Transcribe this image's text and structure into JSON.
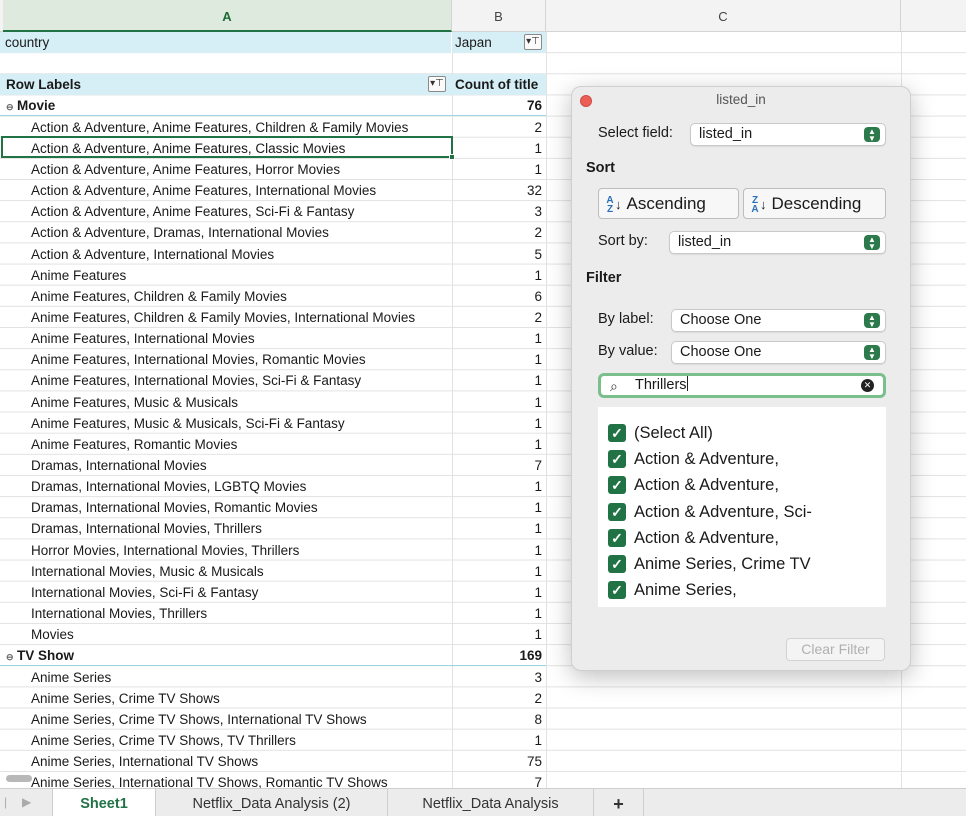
{
  "columns": {
    "a": "A",
    "b": "B",
    "c": "C"
  },
  "filter_field": {
    "label": "country",
    "value": "Japan"
  },
  "pivot_header": {
    "row_labels": "Row Labels",
    "count": "Count of title"
  },
  "groups": [
    {
      "label": "Movie",
      "total": "76",
      "items": [
        {
          "label": "Action & Adventure, Anime Features, Children & Family Movies",
          "count": "2"
        },
        {
          "label": "Action & Adventure, Anime Features, Classic Movies",
          "count": "1"
        },
        {
          "label": "Action & Adventure, Anime Features, Horror Movies",
          "count": "1"
        },
        {
          "label": "Action & Adventure, Anime Features, International Movies",
          "count": "32"
        },
        {
          "label": "Action & Adventure, Anime Features, Sci-Fi & Fantasy",
          "count": "3"
        },
        {
          "label": "Action & Adventure, Dramas, International Movies",
          "count": "2"
        },
        {
          "label": "Action & Adventure, International Movies",
          "count": "5"
        },
        {
          "label": "Anime Features",
          "count": "1"
        },
        {
          "label": "Anime Features, Children & Family Movies",
          "count": "6"
        },
        {
          "label": "Anime Features, Children & Family Movies, International Movies",
          "count": "2"
        },
        {
          "label": "Anime Features, International Movies",
          "count": "1"
        },
        {
          "label": "Anime Features, International Movies, Romantic Movies",
          "count": "1"
        },
        {
          "label": "Anime Features, International Movies, Sci-Fi & Fantasy",
          "count": "1"
        },
        {
          "label": "Anime Features, Music & Musicals",
          "count": "1"
        },
        {
          "label": "Anime Features, Music & Musicals, Sci-Fi & Fantasy",
          "count": "1"
        },
        {
          "label": "Anime Features, Romantic Movies",
          "count": "1"
        },
        {
          "label": "Dramas, International Movies",
          "count": "7"
        },
        {
          "label": "Dramas, International Movies, LGBTQ Movies",
          "count": "1"
        },
        {
          "label": "Dramas, International Movies, Romantic Movies",
          "count": "1"
        },
        {
          "label": "Dramas, International Movies, Thrillers",
          "count": "1"
        },
        {
          "label": "Horror Movies, International Movies, Thrillers",
          "count": "1"
        },
        {
          "label": "International Movies, Music & Musicals",
          "count": "1"
        },
        {
          "label": "International Movies, Sci-Fi & Fantasy",
          "count": "1"
        },
        {
          "label": "International Movies, Thrillers",
          "count": "1"
        },
        {
          "label": "Movies",
          "count": "1"
        }
      ]
    },
    {
      "label": "TV Show",
      "total": "169",
      "items": [
        {
          "label": "Anime Series",
          "count": "3"
        },
        {
          "label": "Anime Series, Crime TV Shows",
          "count": "2"
        },
        {
          "label": "Anime Series, Crime TV Shows, International TV Shows",
          "count": "8"
        },
        {
          "label": "Anime Series, Crime TV Shows, TV Thrillers",
          "count": "1"
        },
        {
          "label": "Anime Series, International TV Shows",
          "count": "75"
        },
        {
          "label": "Anime Series, International TV Shows, Romantic TV Shows",
          "count": "7"
        }
      ]
    }
  ],
  "panel": {
    "title": "listed_in",
    "select_field_label": "Select field:",
    "select_field_value": "listed_in",
    "sort_heading": "Sort",
    "ascending": "Ascending",
    "descending": "Descending",
    "sort_by_label": "Sort by:",
    "sort_by_value": "listed_in",
    "filter_heading": "Filter",
    "by_label_label": "By label:",
    "by_label_value": "Choose One",
    "by_value_label": "By value:",
    "by_value_value": "Choose One",
    "search_value": "Thrillers",
    "list_items": [
      "(Select All)",
      "Action & Adventure,",
      "Action & Adventure,",
      "Action & Adventure, Sci-",
      "Action & Adventure,",
      "Anime Series, Crime TV",
      "Anime Series,"
    ],
    "clear_filter": "Clear Filter"
  },
  "sheet_tabs": [
    "Sheet1",
    "Netflix_Data Analysis (2)",
    "Netflix_Data Analysis"
  ],
  "active_tab": "Sheet1",
  "add_sheet": "+",
  "colors": {
    "accent": "#217346",
    "pivot_header_bg": "#d6eef6",
    "close_button": "#ec5f56"
  }
}
